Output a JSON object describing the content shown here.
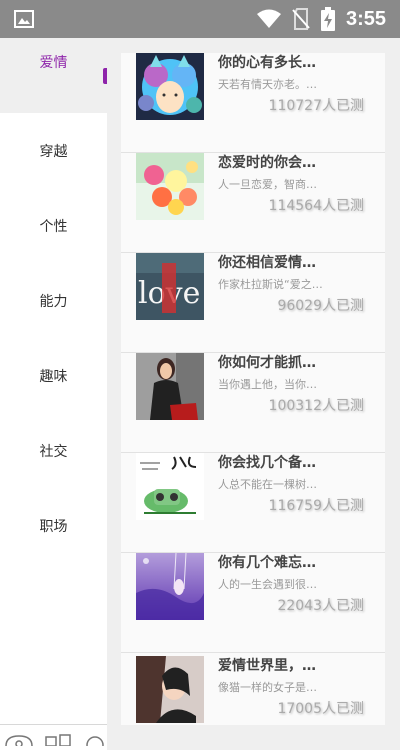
{
  "status": {
    "time": "3:55"
  },
  "categories": [
    {
      "label": "爱情",
      "active": true
    },
    {
      "label": "穿越"
    },
    {
      "label": "个性"
    },
    {
      "label": "能力"
    },
    {
      "label": "趣味"
    },
    {
      "label": "社交"
    },
    {
      "label": "职场"
    }
  ],
  "tests": [
    {
      "title": "你的心有多长…",
      "desc": "天若有情天亦老。…",
      "count": "110727人已测",
      "image": "cartoon-cat-girl"
    },
    {
      "title": "恋爱时的你会…",
      "desc": "人一旦恋爱，智商…",
      "count": "114564人已测",
      "image": "flowers-photo"
    },
    {
      "title": "你还相信爱情…",
      "desc": "作家杜拉斯说“爱之…",
      "count": "96029人已测",
      "image": "love-letters-photo"
    },
    {
      "title": "你如何才能抓…",
      "desc": "当你遇上他，当你…",
      "count": "100312人已测",
      "image": "woman-portrait-photo"
    },
    {
      "title": "你会找几个备…",
      "desc": "人总不能在一棵树…",
      "count": "116759人已测",
      "image": "handwritten-drawing"
    },
    {
      "title": "你有几个难忘…",
      "desc": "人的一生会遇到很…",
      "count": "22043人已测",
      "image": "girl-on-swing-photo"
    },
    {
      "title": "爱情世界里，…",
      "desc": "像猫一样的女子是…",
      "count": "17005人已测",
      "image": "woman-photo"
    }
  ],
  "colors": {
    "accent": "#8e24aa",
    "status_bar": "#8a8a8a"
  }
}
